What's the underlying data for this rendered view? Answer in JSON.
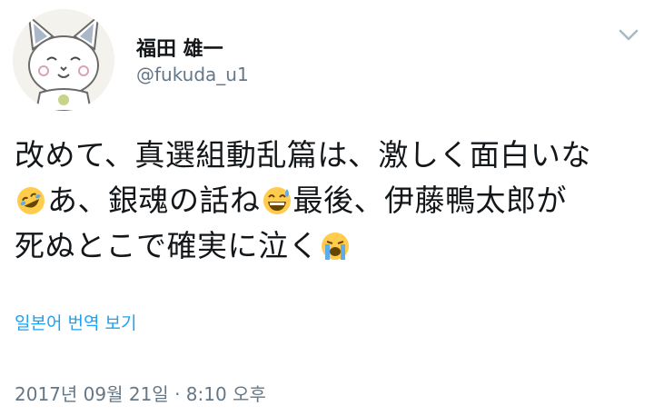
{
  "user": {
    "display_name": "福田 雄一",
    "handle": "@fukuda_u1"
  },
  "tweet": {
    "line1": "改めて、真選組動乱篇は、激しく面白いな",
    "line2_a": "あ、銀魂の話ね",
    "line2_b": "最後、伊藤鴨太郎が",
    "line3": "死ぬとこで確実に泣く",
    "emojis": [
      "rolling-on-floor-laughing-emoji",
      "grinning-sweat-emoji",
      "loudly-crying-emoji"
    ]
  },
  "translate_label": "일본어 번역 보기",
  "timestamp": "2017년 09월 21일 · 8:10 오후",
  "icons": {
    "menu": "chevron-down-icon"
  },
  "colors": {
    "link": "#1da1f2",
    "secondary_text": "#657786",
    "primary_text": "#14171a"
  }
}
